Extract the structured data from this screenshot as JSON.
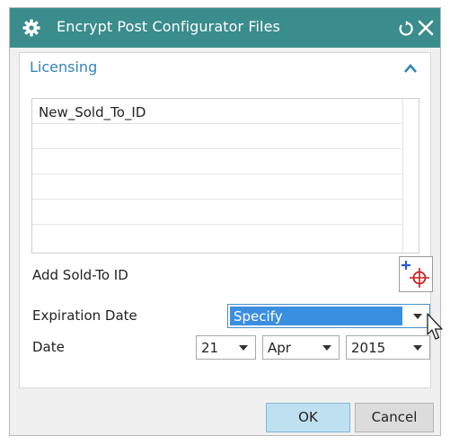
{
  "window": {
    "title": "Encrypt Post Configurator Files",
    "colors": {
      "titlebar": "#3b8c8c",
      "accent": "#3585b9",
      "selection": "#3b8fe0"
    }
  },
  "section": {
    "title": "Licensing",
    "collapse_icon": "chevron-up-icon"
  },
  "sold_to_list": {
    "items": [
      "New_Sold_To_ID",
      "",
      "",
      "",
      "",
      ""
    ]
  },
  "add_sold_to": {
    "label": "Add Sold-To ID",
    "icon": "add-point-icon"
  },
  "expiration": {
    "label": "Expiration Date",
    "value": "Specify"
  },
  "date": {
    "label": "Date",
    "day": "21",
    "month": "Apr",
    "year": "2015"
  },
  "buttons": {
    "ok": "OK",
    "cancel": "Cancel"
  }
}
